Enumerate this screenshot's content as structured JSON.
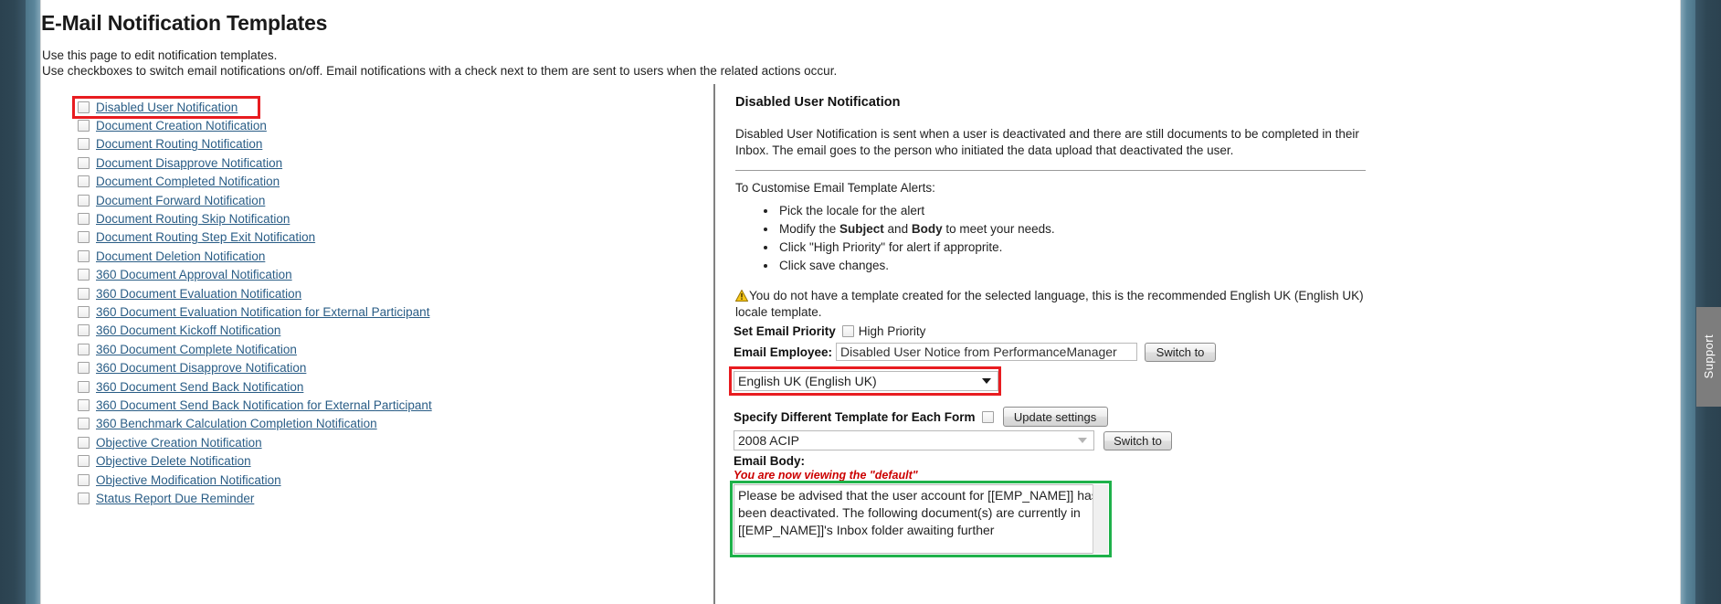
{
  "page": {
    "title": "E-Mail Notification Templates",
    "intro_line1": "Use this page to edit notification templates.",
    "intro_line2": "Use checkboxes to switch email notifications on/off. Email notifications with a check next to them are sent to users when the related actions occur."
  },
  "chrome": {
    "support_tab": "Support"
  },
  "notifications": [
    {
      "label": "Disabled User Notification",
      "checked": false,
      "highlighted": true
    },
    {
      "label": "Document Creation Notification",
      "checked": false
    },
    {
      "label": "Document Routing Notification",
      "checked": false
    },
    {
      "label": "Document Disapprove Notification",
      "checked": false
    },
    {
      "label": "Document Completed Notification",
      "checked": false
    },
    {
      "label": "Document Forward Notification",
      "checked": false
    },
    {
      "label": "Document Routing Skip Notification",
      "checked": false
    },
    {
      "label": "Document Routing Step Exit Notification",
      "checked": false
    },
    {
      "label": "Document Deletion Notification",
      "checked": false
    },
    {
      "label": "360 Document Approval Notification",
      "checked": false
    },
    {
      "label": "360 Document Evaluation Notification",
      "checked": false
    },
    {
      "label": "360 Document Evaluation Notification for External Participant",
      "checked": false
    },
    {
      "label": "360 Document Kickoff Notification",
      "checked": false
    },
    {
      "label": "360 Document Complete Notification",
      "checked": false
    },
    {
      "label": "360 Document Disapprove Notification",
      "checked": false
    },
    {
      "label": "360 Document Send Back Notification",
      "checked": false
    },
    {
      "label": "360 Document Send Back Notification for External Participant",
      "checked": false
    },
    {
      "label": "360 Benchmark Calculation Completion Notification",
      "checked": false
    },
    {
      "label": "Objective Creation Notification",
      "checked": false
    },
    {
      "label": "Objective Delete Notification",
      "checked": false
    },
    {
      "label": "Objective Modification Notification",
      "checked": false
    },
    {
      "label": "Status Report Due Reminder",
      "checked": false
    }
  ],
  "detail": {
    "heading": "Disabled User Notification",
    "description": "Disabled User Notification is sent when a user is deactivated and there are still documents to be completed in their Inbox. The email goes to the person who initiated the data upload that deactivated the user.",
    "customise_heading": "To Customise Email Template Alerts:",
    "steps": [
      "Pick the locale for the alert",
      "Modify the Subject and Body to meet your needs.",
      "Click \"High Priority\" for alert if approprite.",
      "Click save changes."
    ],
    "step2_prefix": "Modify the ",
    "step2_bold1": "Subject",
    "step2_mid": " and ",
    "step2_bold2": "Body",
    "step2_suffix": " to meet your needs.",
    "warning": "You do not have a template created for the selected language, this is the recommended English UK (English UK) locale template."
  },
  "form": {
    "priority_label": "Set Email Priority",
    "high_priority_label": "High Priority",
    "high_priority_checked": false,
    "email_employee_label": "Email Employee:",
    "subject_value": "Disabled User Notice from PerformanceManager",
    "subject_switch_button": "Switch to",
    "locale_value": "English UK (English UK)",
    "locale_options": [
      "English UK (English UK)"
    ],
    "specify_template_label": "Specify Different Template for Each Form",
    "specify_template_checked": false,
    "update_settings_button": "Update settings",
    "form_value": "2008 ACIP",
    "form_options": [
      "2008 ACIP"
    ],
    "form_switch_button": "Switch to",
    "email_body_label": "Email Body:",
    "viewing_default_note": "You are now viewing the \"default\"",
    "email_body_value": "Please be advised that the user account for [[EMP_NAME]] has been deactivated.  The following document(s) are currently in [[EMP_NAME]]'s Inbox folder awaiting further"
  },
  "colors": {
    "link": "#2a5d86",
    "highlight_red": "#e81c20",
    "highlight_green": "#1eb14a",
    "note_red": "#cc0000"
  }
}
